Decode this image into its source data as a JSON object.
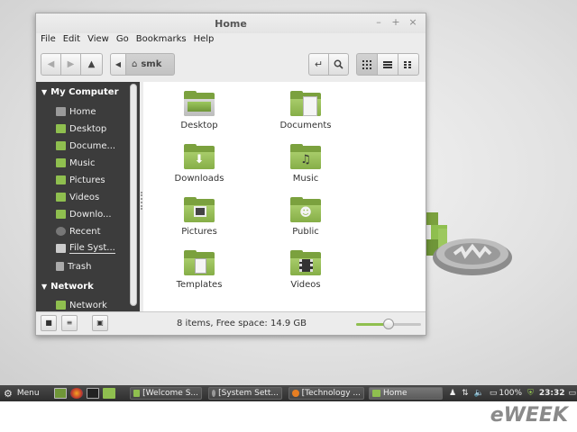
{
  "window": {
    "title": "Home",
    "controls": {
      "minimize": "–",
      "maximize": "+",
      "close": "×"
    }
  },
  "menubar": [
    "File",
    "Edit",
    "View",
    "Go",
    "Bookmarks",
    "Help"
  ],
  "toolbar": {
    "location": "smk"
  },
  "sidebar": {
    "section_computer": "My Computer",
    "computer_items": [
      {
        "label": "Home",
        "icon": "home-icon"
      },
      {
        "label": "Desktop",
        "icon": "desktop-icon"
      },
      {
        "label": "Docume...",
        "icon": "documents-folder-icon"
      },
      {
        "label": "Music",
        "icon": "music-folder-icon"
      },
      {
        "label": "Pictures",
        "icon": "pictures-folder-icon"
      },
      {
        "label": "Videos",
        "icon": "videos-folder-icon"
      },
      {
        "label": "Downlo...",
        "icon": "downloads-folder-icon"
      },
      {
        "label": "Recent",
        "icon": "clock-icon"
      },
      {
        "label": "File Syst...",
        "icon": "drive-icon"
      },
      {
        "label": "Trash",
        "icon": "trash-icon"
      }
    ],
    "section_network": "Network",
    "network_items": [
      {
        "label": "Network",
        "icon": "network-icon"
      }
    ]
  },
  "files": [
    {
      "label": "Desktop",
      "icon": "desktop-folder-icon"
    },
    {
      "label": "Documents",
      "icon": "documents-folder-icon"
    },
    {
      "label": "Downloads",
      "icon": "downloads-folder-icon"
    },
    {
      "label": "Music",
      "icon": "music-folder-icon"
    },
    {
      "label": "Pictures",
      "icon": "pictures-folder-icon"
    },
    {
      "label": "Public",
      "icon": "public-folder-icon"
    },
    {
      "label": "Templates",
      "icon": "templates-folder-icon"
    },
    {
      "label": "Videos",
      "icon": "videos-folder-icon"
    }
  ],
  "statusbar": {
    "text": "8 items, Free space: 14.9 GB",
    "zoom_level": 0.5
  },
  "taskbar": {
    "menu": "Menu",
    "tasks": [
      {
        "label": "[Welcome S...",
        "icon": "folder-icon",
        "active": false
      },
      {
        "label": "[System Sett...",
        "icon": "settings-icon",
        "active": false
      },
      {
        "label": "[Technology ...",
        "icon": "firefox-icon",
        "active": false
      },
      {
        "label": "Home",
        "icon": "folder-icon",
        "active": true
      }
    ],
    "battery": "100%",
    "clock": "23:32"
  },
  "brand": "eWEEK",
  "colors": {
    "accent_green": "#86ae47",
    "sidebar_bg": "#3c3c3c"
  }
}
